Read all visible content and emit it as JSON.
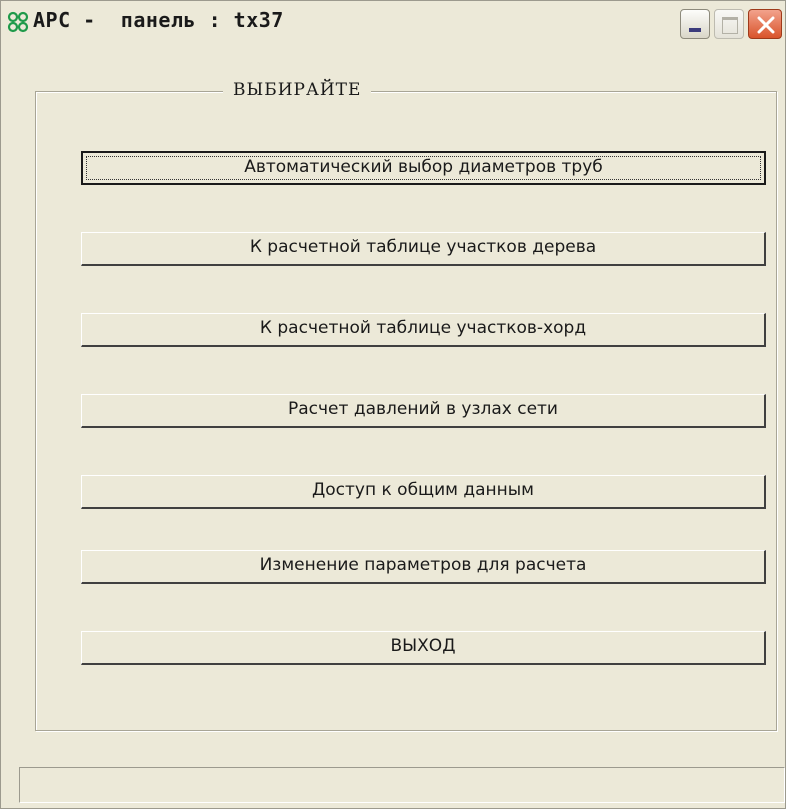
{
  "window": {
    "title": "АРС -  панель : tx37",
    "close_color": "#d9542b"
  },
  "group": {
    "legend": "ВЫБИРАЙТЕ"
  },
  "buttons": [
    {
      "label": "Автоматический выбор диаметров труб",
      "focused": true
    },
    {
      "label": "К расчетной таблице участков дерева"
    },
    {
      "label": "К расчетной таблице участков-хорд"
    },
    {
      "label": "Расчет давлений в узлах сети"
    },
    {
      "label": "Доступ к общим данным"
    },
    {
      "label": "Изменение параметров для расчета"
    },
    {
      "label": "ВЫХОД"
    }
  ],
  "statusbar": {
    "text": ""
  }
}
